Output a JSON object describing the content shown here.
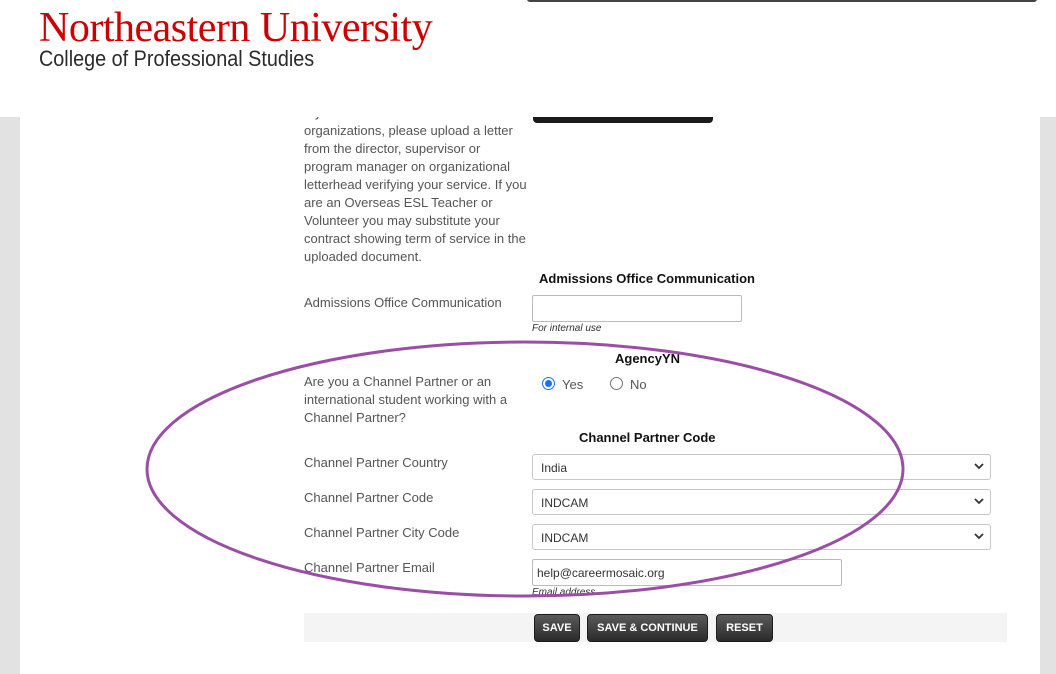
{
  "header": {
    "university_name": "Northeastern University",
    "college_name": "College of Professional Studies"
  },
  "form": {
    "full_circle_help": "If you are a member of Full Circle organizations, please upload a letter from the director, supervisor or program manager on organizational letterhead verifying your service. If you are an Overseas ESL Teacher or Volunteer you may substitute your contract showing term of service in the uploaded document.",
    "admissions_section_title": "Admissions Office Communication",
    "admissions_label": "Admissions Office Communication",
    "admissions_value": "",
    "admissions_hint": "For internal use",
    "agency_section_title": "AgencyYN",
    "channel_partner_question": "Are you a Channel Partner or an international student working with a Channel Partner?",
    "radio_yes": "Yes",
    "radio_no": "No",
    "radio_selected": "Yes",
    "channel_partner_section_title": "Channel Partner Code",
    "country_label": "Channel Partner Country",
    "country_value": "India",
    "code_label": "Channel Partner Code",
    "code_value": "INDCAM",
    "city_code_label": "Channel Partner City Code",
    "city_code_value": "INDCAM",
    "email_label": "Channel Partner Email",
    "email_value": "help@careermosaic.org",
    "email_hint": "Email address"
  },
  "buttons": {
    "save": "SAVE",
    "save_continue": "SAVE & CONTINUE",
    "reset": "RESET"
  },
  "annotation": {
    "oval_color": "#9b4ea6"
  },
  "icons": {
    "select_arrow": "chevron-down-icon"
  }
}
